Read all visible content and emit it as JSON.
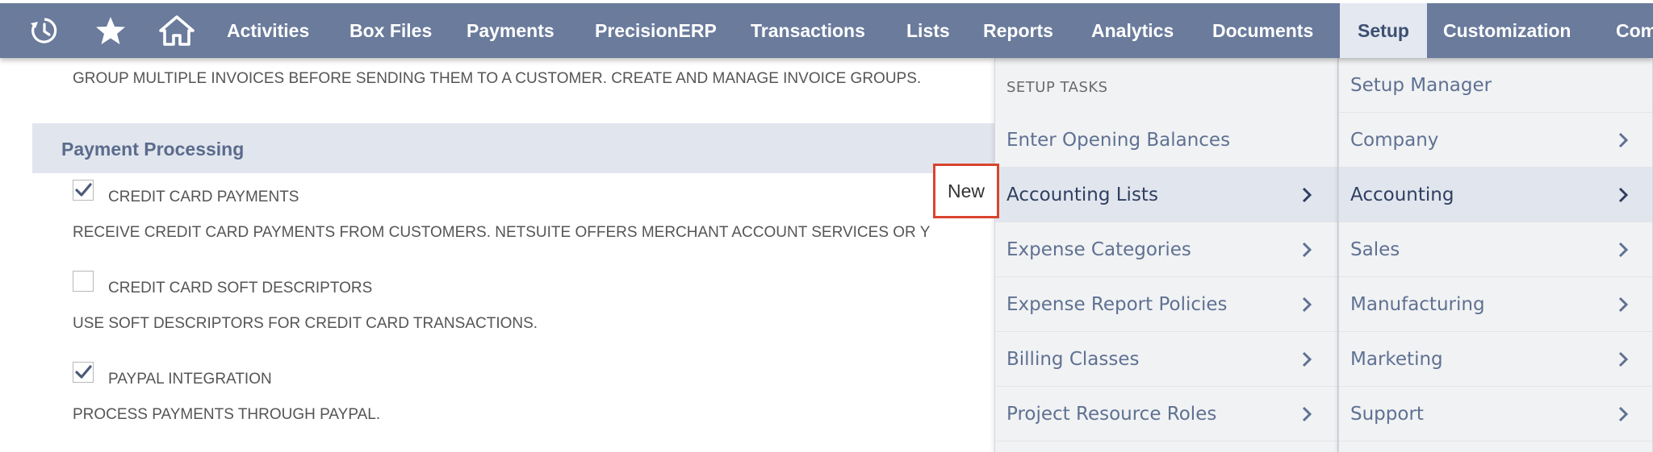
{
  "nav": {
    "items": [
      {
        "label": "Activities"
      },
      {
        "label": "Box Files"
      },
      {
        "label": "Payments"
      },
      {
        "label": "PrecisionERP"
      },
      {
        "label": "Transactions"
      },
      {
        "label": "Lists"
      },
      {
        "label": "Reports"
      },
      {
        "label": "Analytics"
      },
      {
        "label": "Documents"
      },
      {
        "label": "Setup"
      },
      {
        "label": "Customization"
      },
      {
        "label": "Com"
      }
    ],
    "active": "Setup",
    "icons": [
      "recent-history-icon",
      "star-icon",
      "home-icon"
    ]
  },
  "content": {
    "intro_text": "GROUP MULTIPLE INVOICES BEFORE SENDING THEM TO A CUSTOMER. CREATE AND MANAGE INVOICE GROUPS.",
    "section_title": "Payment Processing",
    "options": [
      {
        "label": "CREDIT CARD PAYMENTS",
        "checked": true,
        "description": "RECEIVE CREDIT CARD PAYMENTS FROM CUSTOMERS. NETSUITE OFFERS MERCHANT ACCOUNT SERVICES OR Y"
      },
      {
        "label": "CREDIT CARD SOFT DESCRIPTORS",
        "checked": false,
        "description": "USE SOFT DESCRIPTORS FOR CREDIT CARD TRANSACTIONS."
      },
      {
        "label": "PAYPAL INTEGRATION",
        "checked": true,
        "description": "PROCESS PAYMENTS THROUGH PAYPAL."
      }
    ],
    "new_link": "New"
  },
  "setup_menu": {
    "heading": "SETUP TASKS",
    "items": [
      {
        "label": "Enter Opening Balances",
        "submenu": false
      },
      {
        "label": "Accounting Lists",
        "submenu": true
      },
      {
        "label": "Expense Categories",
        "submenu": true
      },
      {
        "label": "Expense Report Policies",
        "submenu": true
      },
      {
        "label": "Billing Classes",
        "submenu": true
      },
      {
        "label": "Project Resource Roles",
        "submenu": true
      }
    ],
    "hovered": "Accounting Lists"
  },
  "setup_manager_menu": {
    "items": [
      {
        "label": "Setup Manager",
        "submenu": false
      },
      {
        "label": "Company",
        "submenu": true
      },
      {
        "label": "Accounting",
        "submenu": true
      },
      {
        "label": "Sales",
        "submenu": true
      },
      {
        "label": "Manufacturing",
        "submenu": true
      },
      {
        "label": "Marketing",
        "submenu": true
      },
      {
        "label": "Support",
        "submenu": true
      }
    ],
    "hovered": "Accounting"
  },
  "colors": {
    "nav_bg": "#6a7b9c",
    "nav_active_bg": "#e4e8f0",
    "section_bg": "#e1e6ee",
    "highlight_border": "#d9442e"
  }
}
